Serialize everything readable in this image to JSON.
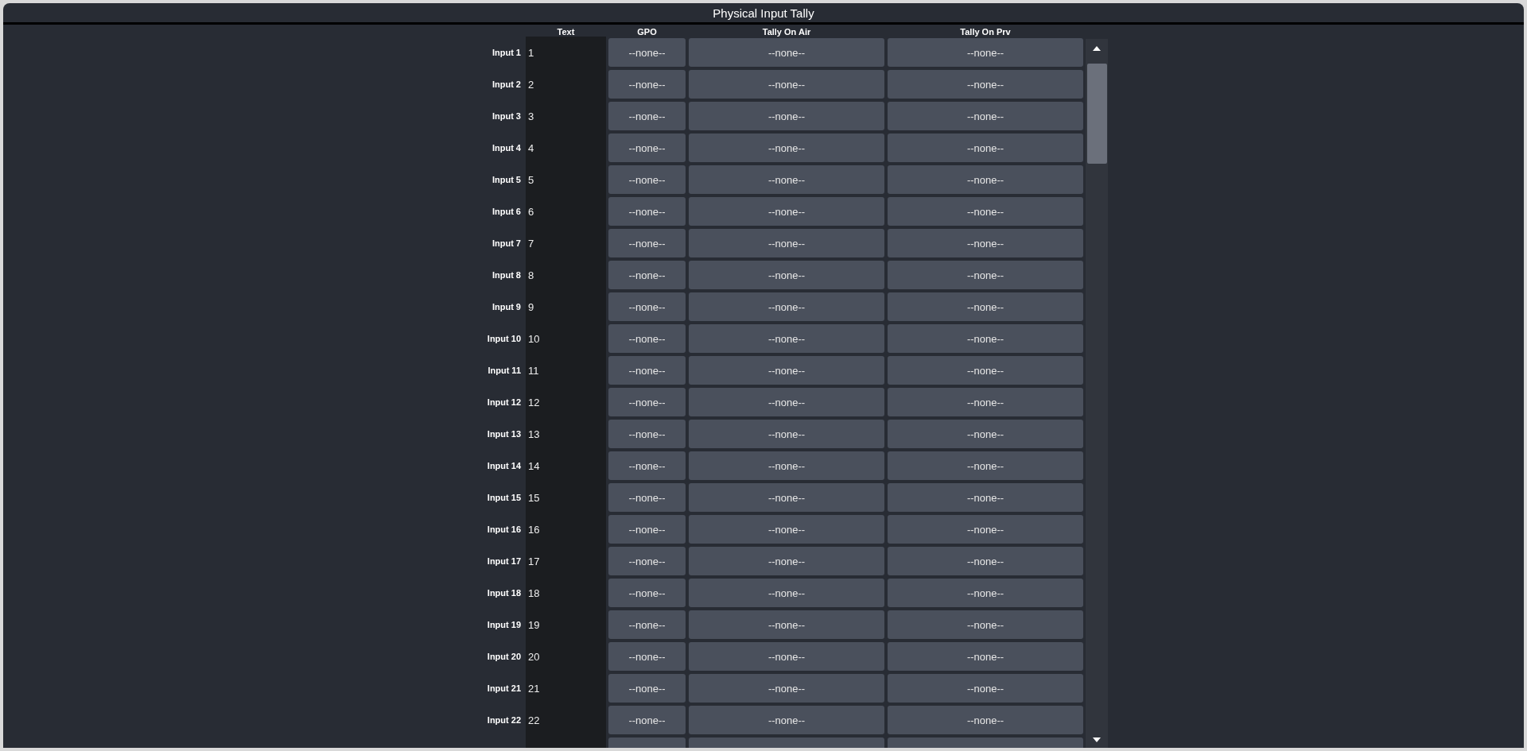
{
  "window": {
    "title": "Physical Input Tally"
  },
  "table": {
    "columns": [
      "Text",
      "GPO",
      "Tally On Air",
      "Tally On Prv"
    ],
    "rows": [
      {
        "label": "Input 1",
        "text": "1",
        "gpo": "--none--",
        "tally_on_air": "--none--",
        "tally_on_prv": "--none--"
      },
      {
        "label": "Input 2",
        "text": "2",
        "gpo": "--none--",
        "tally_on_air": "--none--",
        "tally_on_prv": "--none--"
      },
      {
        "label": "Input 3",
        "text": "3",
        "gpo": "--none--",
        "tally_on_air": "--none--",
        "tally_on_prv": "--none--"
      },
      {
        "label": "Input 4",
        "text": "4",
        "gpo": "--none--",
        "tally_on_air": "--none--",
        "tally_on_prv": "--none--"
      },
      {
        "label": "Input 5",
        "text": "5",
        "gpo": "--none--",
        "tally_on_air": "--none--",
        "tally_on_prv": "--none--"
      },
      {
        "label": "Input 6",
        "text": "6",
        "gpo": "--none--",
        "tally_on_air": "--none--",
        "tally_on_prv": "--none--"
      },
      {
        "label": "Input 7",
        "text": "7",
        "gpo": "--none--",
        "tally_on_air": "--none--",
        "tally_on_prv": "--none--"
      },
      {
        "label": "Input 8",
        "text": "8",
        "gpo": "--none--",
        "tally_on_air": "--none--",
        "tally_on_prv": "--none--"
      },
      {
        "label": "Input 9",
        "text": "9",
        "gpo": "--none--",
        "tally_on_air": "--none--",
        "tally_on_prv": "--none--"
      },
      {
        "label": "Input 10",
        "text": "10",
        "gpo": "--none--",
        "tally_on_air": "--none--",
        "tally_on_prv": "--none--"
      },
      {
        "label": "Input 11",
        "text": "11",
        "gpo": "--none--",
        "tally_on_air": "--none--",
        "tally_on_prv": "--none--"
      },
      {
        "label": "Input 12",
        "text": "12",
        "gpo": "--none--",
        "tally_on_air": "--none--",
        "tally_on_prv": "--none--"
      },
      {
        "label": "Input 13",
        "text": "13",
        "gpo": "--none--",
        "tally_on_air": "--none--",
        "tally_on_prv": "--none--"
      },
      {
        "label": "Input 14",
        "text": "14",
        "gpo": "--none--",
        "tally_on_air": "--none--",
        "tally_on_prv": "--none--"
      },
      {
        "label": "Input 15",
        "text": "15",
        "gpo": "--none--",
        "tally_on_air": "--none--",
        "tally_on_prv": "--none--"
      },
      {
        "label": "Input 16",
        "text": "16",
        "gpo": "--none--",
        "tally_on_air": "--none--",
        "tally_on_prv": "--none--"
      },
      {
        "label": "Input 17",
        "text": "17",
        "gpo": "--none--",
        "tally_on_air": "--none--",
        "tally_on_prv": "--none--"
      },
      {
        "label": "Input 18",
        "text": "18",
        "gpo": "--none--",
        "tally_on_air": "--none--",
        "tally_on_prv": "--none--"
      },
      {
        "label": "Input 19",
        "text": "19",
        "gpo": "--none--",
        "tally_on_air": "--none--",
        "tally_on_prv": "--none--"
      },
      {
        "label": "Input 20",
        "text": "20",
        "gpo": "--none--",
        "tally_on_air": "--none--",
        "tally_on_prv": "--none--"
      },
      {
        "label": "Input 21",
        "text": "21",
        "gpo": "--none--",
        "tally_on_air": "--none--",
        "tally_on_prv": "--none--"
      },
      {
        "label": "Input 22",
        "text": "22",
        "gpo": "--none--",
        "tally_on_air": "--none--",
        "tally_on_prv": "--none--"
      }
    ]
  }
}
